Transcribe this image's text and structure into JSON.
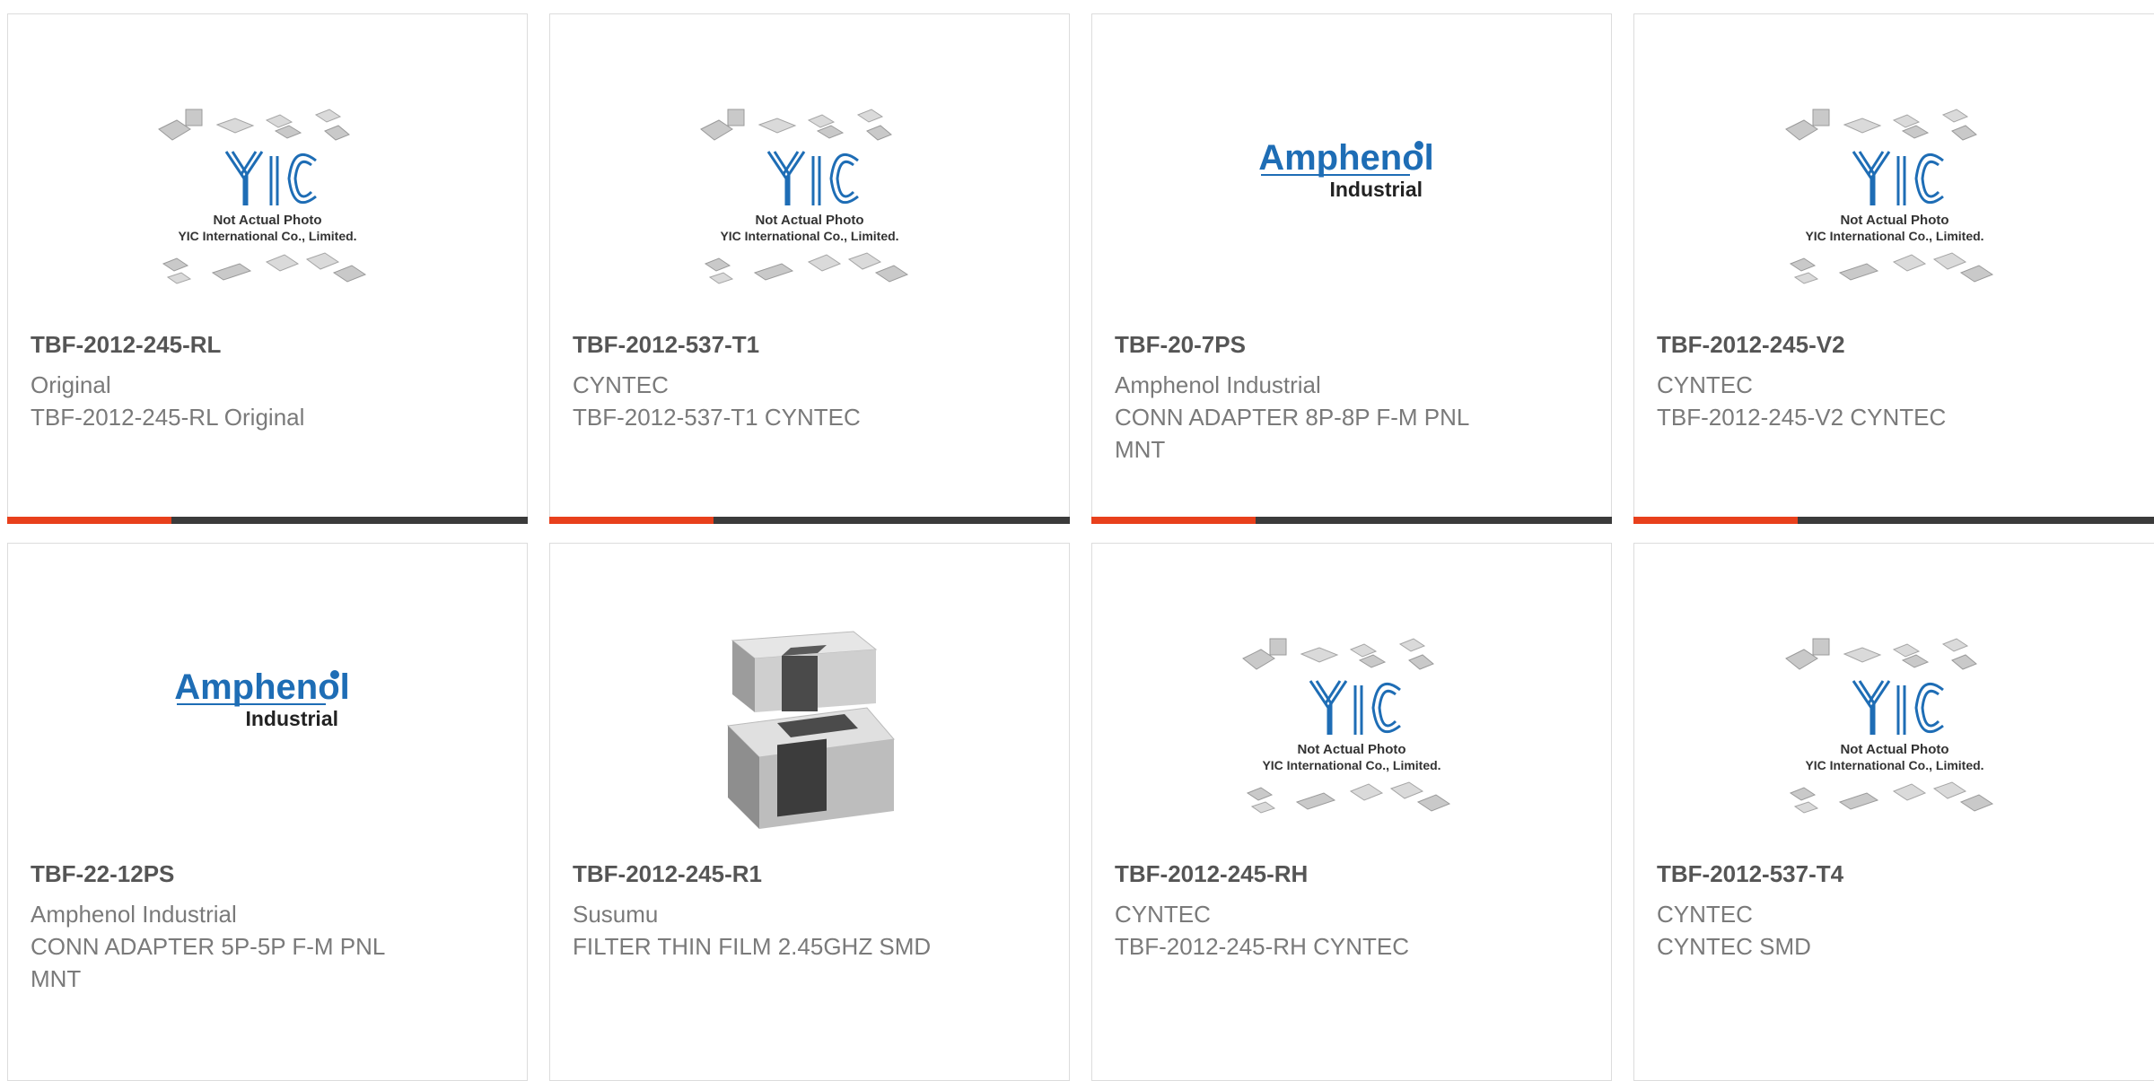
{
  "products": [
    {
      "part": "TBF-2012-245-RL",
      "brand": "Original",
      "desc": "TBF-2012-245-RL Original",
      "image": "yic-placeholder",
      "photo_note": "Not Actual Photo",
      "company": "YIC International Co., Limited."
    },
    {
      "part": "TBF-2012-537-T1",
      "brand": "CYNTEC",
      "desc": "TBF-2012-537-T1 CYNTEC",
      "image": "yic-placeholder",
      "photo_note": "Not Actual Photo",
      "company": "YIC International Co., Limited."
    },
    {
      "part": "TBF-20-7PS",
      "brand": "Amphenol Industrial",
      "desc": "CONN ADAPTER 8P-8P F-M PNL MNT",
      "image": "amphenol-logo",
      "logo_main": "Amphenol",
      "logo_sub": "Industrial"
    },
    {
      "part": "TBF-2012-245-V2",
      "brand": "CYNTEC",
      "desc": "TBF-2012-245-V2 CYNTEC",
      "image": "yic-placeholder",
      "photo_note": "Not Actual Photo",
      "company": "YIC International Co., Limited."
    },
    {
      "part": "TBF-22-12PS",
      "brand": "Amphenol Industrial",
      "desc": "CONN ADAPTER 5P-5P F-M PNL MNT",
      "image": "amphenol-logo",
      "logo_main": "Amphenol",
      "logo_sub": "Industrial"
    },
    {
      "part": "TBF-2012-245-R1",
      "brand": "Susumu",
      "desc": "FILTER THIN FILM 2.45GHZ SMD",
      "image": "chip-photo"
    },
    {
      "part": "TBF-2012-245-RH",
      "brand": "CYNTEC",
      "desc": "TBF-2012-245-RH CYNTEC",
      "image": "yic-placeholder",
      "photo_note": "Not Actual Photo",
      "company": "YIC International Co., Limited."
    },
    {
      "part": "TBF-2012-537-T4",
      "brand": "CYNTEC",
      "desc": "CYNTEC SMD",
      "image": "yic-placeholder",
      "photo_note": "Not Actual Photo",
      "company": "YIC International Co., Limited."
    }
  ],
  "colors": {
    "accent": "#e8401c",
    "bar_dark": "#3b3b3b",
    "title": "#555555",
    "text": "#7a7a7a"
  }
}
